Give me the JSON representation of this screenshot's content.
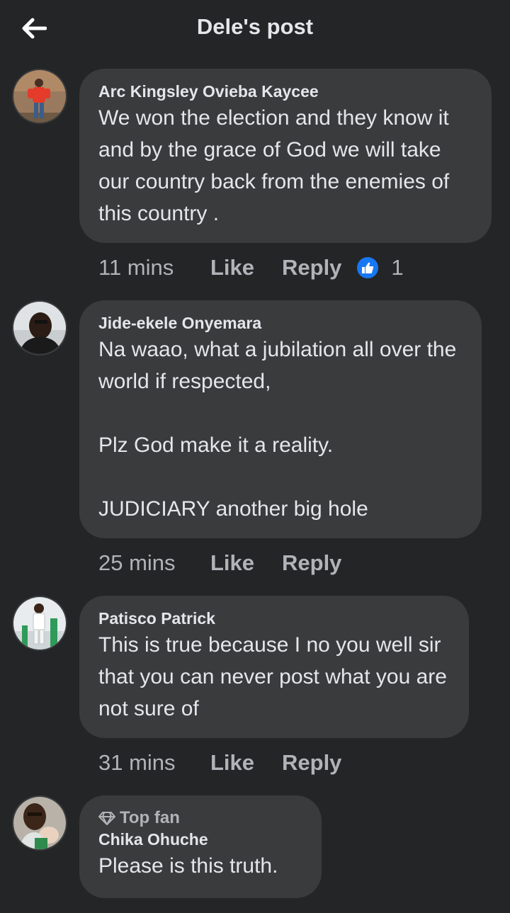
{
  "header": {
    "title": "Dele's post"
  },
  "comments": [
    {
      "author": "Arc Kingsley Ovieba Kaycee",
      "text": "We won the election and they know it and by the grace of God we will take our country back from the enemies of this country .",
      "time": "11 mins",
      "like_label": "Like",
      "reply_label": "Reply",
      "reaction_count": "1"
    },
    {
      "author": "Jide-ekele Onyemara",
      "text": "Na waao,  what a jubilation all over the world  if respected,\n\nPlz God make it a reality.\n\nJUDICIARY another big hole",
      "time": "25 mins",
      "like_label": "Like",
      "reply_label": "Reply"
    },
    {
      "author": "Patisco Patrick",
      "text": "This is true because I no you well sir that you can never post what you are not sure of",
      "time": "31 mins",
      "like_label": "Like",
      "reply_label": "Reply"
    },
    {
      "badge": "Top fan",
      "author": "Chika Ohuche",
      "text": "Please is this truth."
    }
  ],
  "colors": {
    "background": "#242526",
    "bubble": "#3a3b3c",
    "primary_text": "#e4e6eb",
    "secondary_text": "#b0b3b8",
    "like_blue": "#1877f2"
  },
  "icons": {
    "back": "arrow-left-icon",
    "reaction": "thumbs-up-icon",
    "badge": "diamond-icon"
  }
}
